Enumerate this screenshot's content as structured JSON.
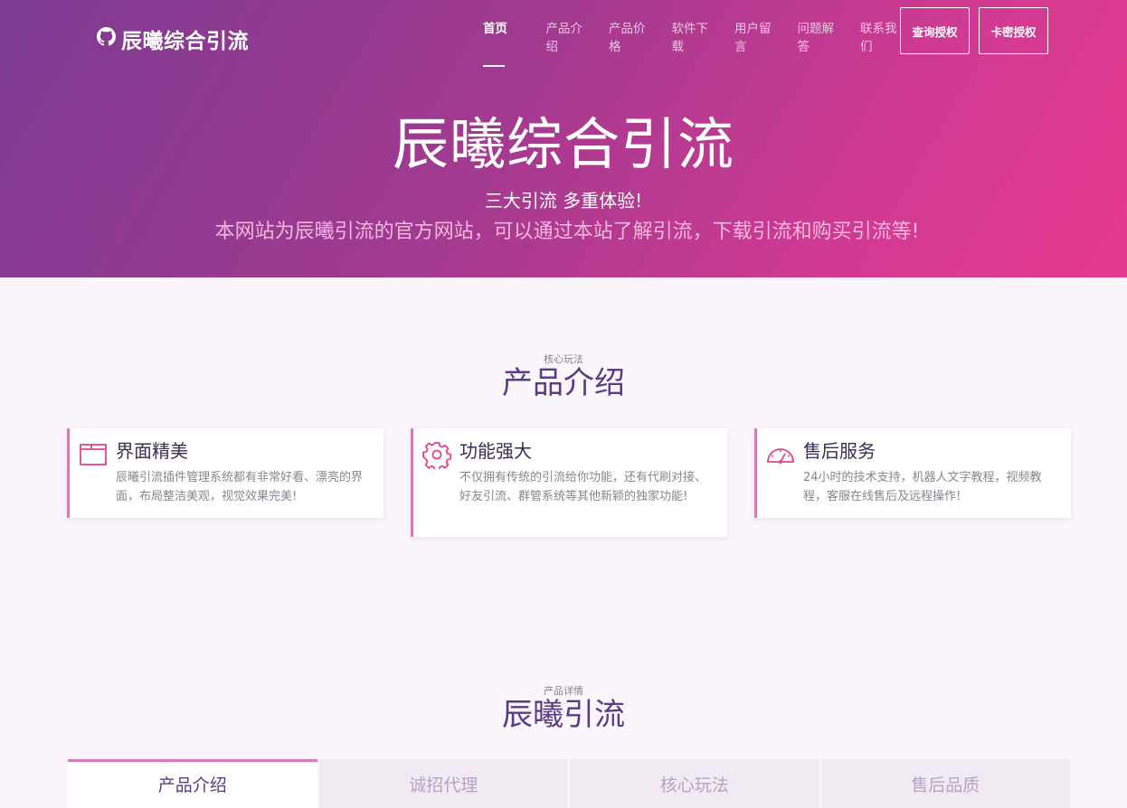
{
  "brand": {
    "name": "辰曦综合引流",
    "icon": "github-icon"
  },
  "nav": {
    "items": [
      {
        "label": "首页",
        "active": true
      },
      {
        "label": "产品介绍",
        "active": false
      },
      {
        "label": "产品价格",
        "active": false
      },
      {
        "label": "软件下载",
        "active": false
      },
      {
        "label": "用户留言",
        "active": false
      },
      {
        "label": "问题解答",
        "active": false
      },
      {
        "label": "联系我们",
        "active": false
      }
    ],
    "query_button": "查询授权",
    "card_button": "卡密授权"
  },
  "hero": {
    "title": "辰曦综合引流",
    "subtitle": "三大引流 多重体验!",
    "description": "本网站为辰曦引流的官方网站，可以通过本站了解引流，下载引流和购买引流等!"
  },
  "intro_section": {
    "kicker": "核心玩法",
    "title": "产品介绍",
    "cards": [
      {
        "icon": "browser-window-icon",
        "title": "界面精美",
        "desc": "辰曦引流插件管理系统都有非常好看、漂亮的界面，布局整洁美观，视觉效果完美!"
      },
      {
        "icon": "gear-icon",
        "title": "功能强大",
        "desc": "不仅拥有传统的引流给你功能，还有代刷对接、好友引流、群管系统等其他新颖的独家功能!"
      },
      {
        "icon": "speedometer-icon",
        "title": "售后服务",
        "desc": "24小时的技术支持，机器人文字教程，视频教程，客服在线售后及远程操作!"
      }
    ]
  },
  "detail_section": {
    "kicker": "产品详情",
    "title": "辰曦引流",
    "tabs": [
      {
        "label": "产品介绍",
        "active": true
      },
      {
        "label": "诚招代理",
        "active": false
      },
      {
        "label": "核心玩法",
        "active": false
      },
      {
        "label": "售后品质",
        "active": false
      }
    ]
  },
  "colors": {
    "hero_gradient_start": "#7d3b92",
    "hero_gradient_end": "#e6398f",
    "accent": "#d37cb7",
    "heading": "#5b3b86",
    "icon": "#e0458f"
  }
}
